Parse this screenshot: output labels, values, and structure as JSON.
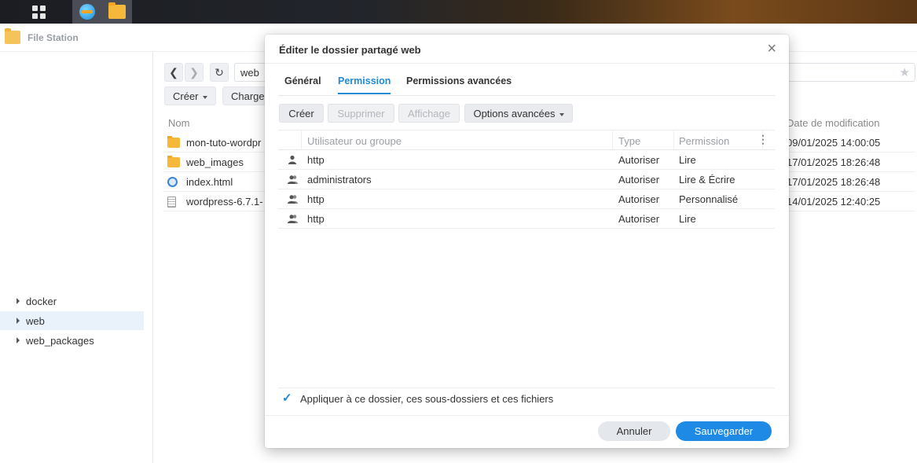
{
  "taskbar": {
    "icons": [
      "main-menu-icon",
      "web-station-icon",
      "file-station-icon"
    ]
  },
  "file_station": {
    "title": "File Station",
    "sidebar": {
      "items": [
        {
          "label": "docker"
        },
        {
          "label": "web"
        },
        {
          "label": "web_packages"
        }
      ],
      "selected": "web"
    },
    "path": "web",
    "toolbar": {
      "create_label": "Créer",
      "upload_label": "Charge"
    },
    "columns": {
      "name": "Nom",
      "modified": "Date de modification"
    },
    "files": [
      {
        "name": "mon-tuto-wordpr",
        "date": "09/01/2025 14:00:05",
        "icon": "folder-icon"
      },
      {
        "name": "web_images",
        "date": "17/01/2025 18:26:48",
        "icon": "folder-icon"
      },
      {
        "name": "index.html",
        "date": "17/01/2025 18:26:48",
        "icon": "html-file-icon"
      },
      {
        "name": "wordpress-6.7.1-",
        "date": "14/01/2025 12:40:25",
        "icon": "archive-file-icon"
      }
    ]
  },
  "dialog": {
    "title": "Éditer le dossier partagé web",
    "tabs": [
      {
        "label": "Général"
      },
      {
        "label": "Permission"
      },
      {
        "label": "Permissions avancées"
      }
    ],
    "active_tab": "Permission",
    "buttons": {
      "create": "Créer",
      "delete": "Supprimer",
      "display": "Affichage",
      "advanced": "Options avancées"
    },
    "columns": {
      "user": "Utilisateur ou groupe",
      "type": "Type",
      "permission": "Permission"
    },
    "rows": [
      {
        "user": "http",
        "type": "Autoriser",
        "permission": "Lire",
        "icon": "user-icon"
      },
      {
        "user": "administrators",
        "type": "Autoriser",
        "permission": "Lire & Écrire",
        "icon": "group-icon"
      },
      {
        "user": "http",
        "type": "Autoriser",
        "permission": "Personnalisé",
        "icon": "group-icon"
      },
      {
        "user": "http",
        "type": "Autoriser",
        "permission": "Lire",
        "icon": "group-icon"
      }
    ],
    "apply_checked": true,
    "apply_label": "Appliquer à ce dossier, ces sous-dossiers et ces fichiers",
    "cancel_label": "Annuler",
    "save_label": "Sauvegarder"
  },
  "colors": {
    "accent": "#1e8ad6",
    "primary_button": "#1e8ae6",
    "folder": "#f6b83b"
  }
}
